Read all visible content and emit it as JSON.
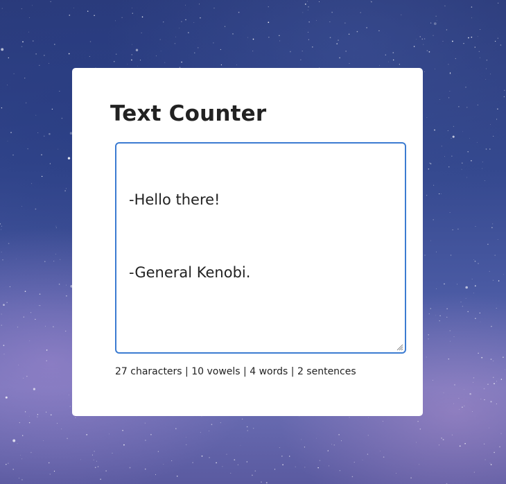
{
  "app": {
    "title": "Text Counter"
  },
  "editor": {
    "lines": [
      "-Hello there!",
      "-General Kenobi."
    ]
  },
  "stats": {
    "characters": "27 characters",
    "vowels": "10 vowels",
    "words": "4 words",
    "sentences": "2 sentences",
    "separator": " | "
  },
  "colors": {
    "card_bg": "#ffffff",
    "accent_border": "#3b7bd1",
    "text": "#222222"
  }
}
